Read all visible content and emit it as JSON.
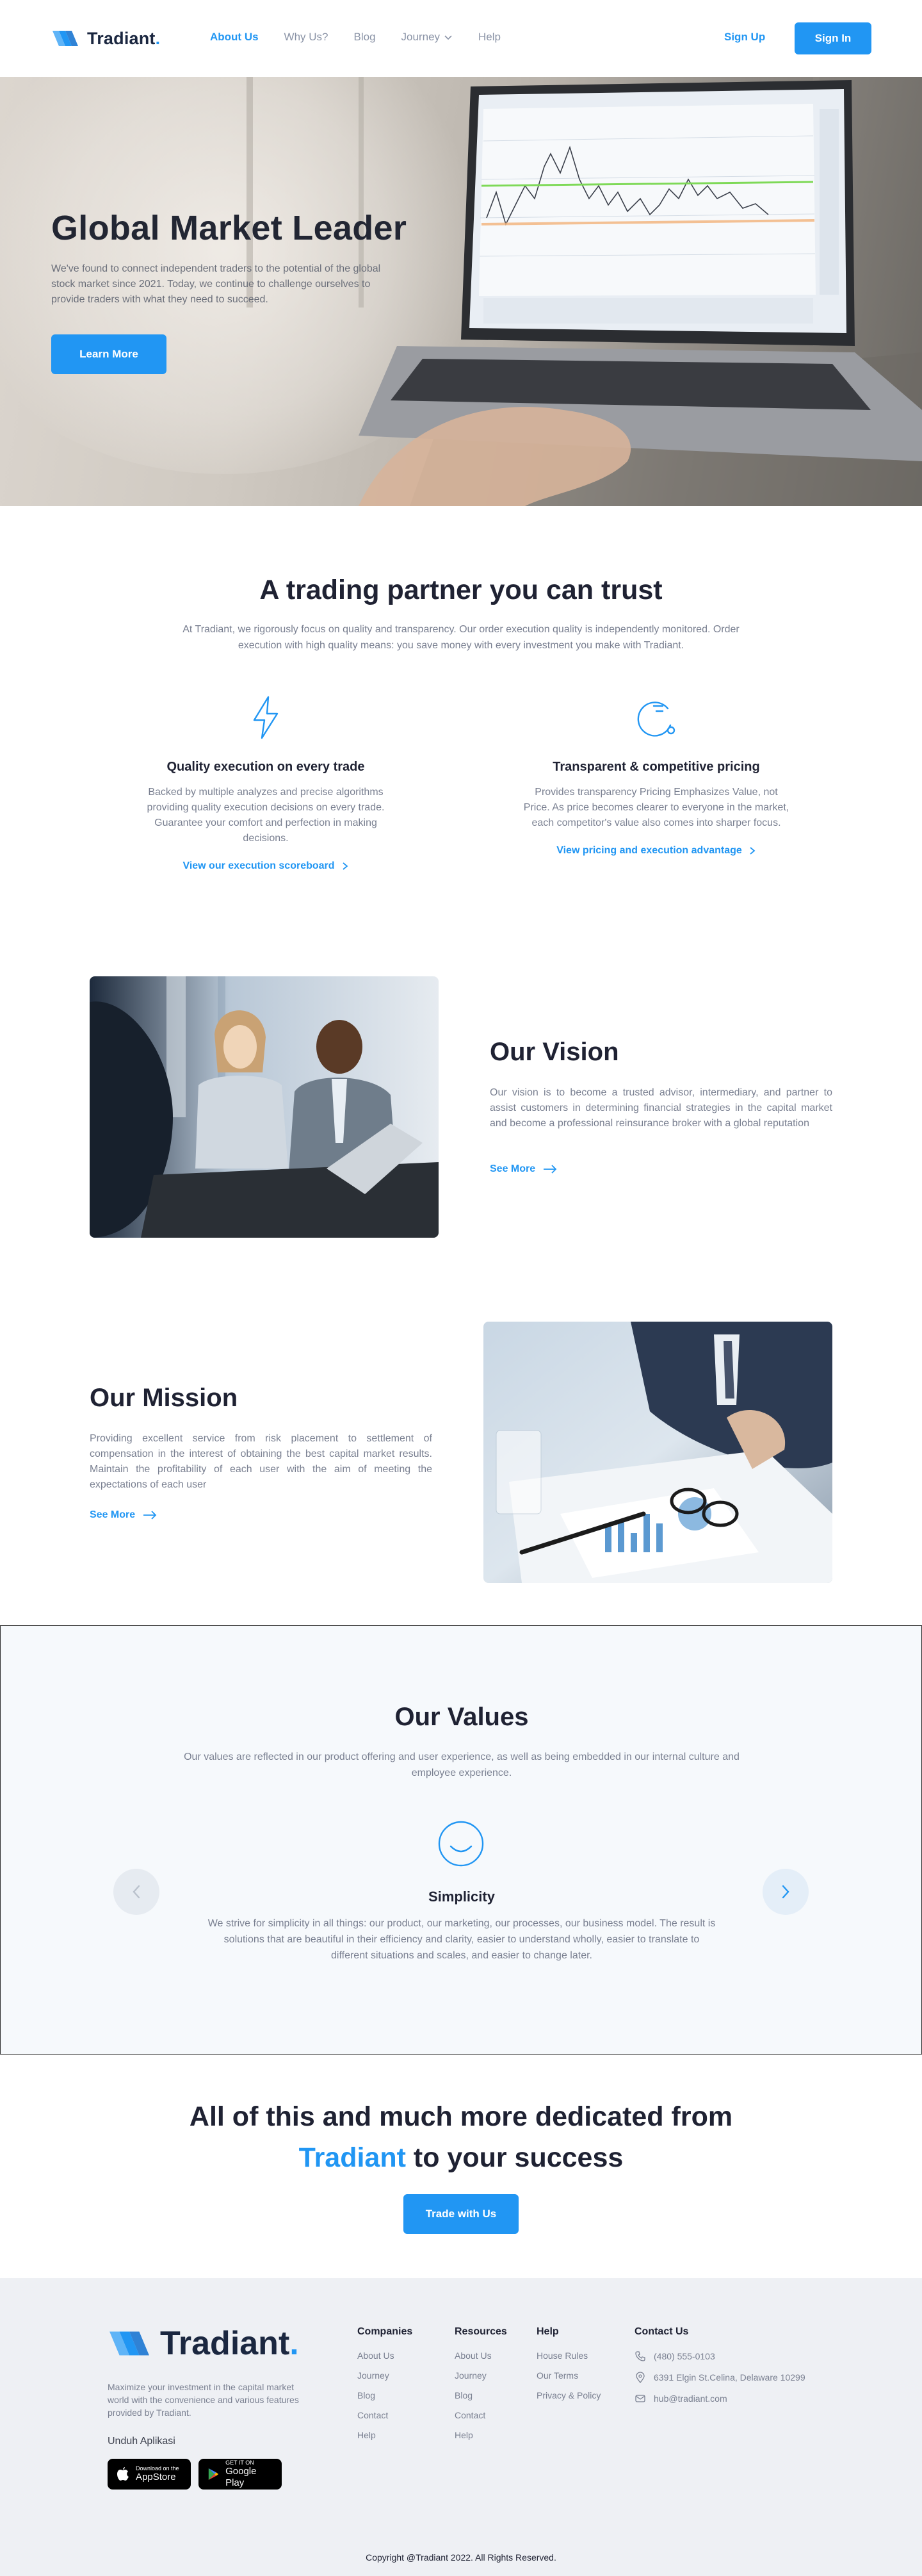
{
  "brand": {
    "name": "Tradiant",
    "dot": ".",
    "accent": "#2196f3",
    "dark": "#1b2740"
  },
  "nav": {
    "links": [
      {
        "label": "About Us",
        "active": true
      },
      {
        "label": "Why Us?"
      },
      {
        "label": "Blog"
      },
      {
        "label": "Journey"
      },
      {
        "label": "Help"
      }
    ],
    "signup": "Sign Up",
    "signin": "Sign In"
  },
  "hero": {
    "title": "Global Market Leader",
    "description": "We've found to connect independent traders to the potential of the global stock market since 2021. Today, we continue to challenge ourselves to provide traders with what they need to succeed.",
    "button": "Learn More"
  },
  "trust": {
    "title": "A trading partner you can trust",
    "description": "At Tradiant, we rigorously focus on quality and transparency. Our order execution quality is independently monitored. Order execution with high quality means: you save money with every investment you make with Tradiant.",
    "features": [
      {
        "icon": "lightning-icon",
        "title": "Quality execution on every trade",
        "description": "Backed by multiple analyzes and precise algorithms providing quality execution decisions on every trade. Guarantee your comfort and perfection in making decisions.",
        "link": "View our execution scoreboard"
      },
      {
        "icon": "pricing-icon",
        "title": "Transparent & competitive pricing",
        "description": "Provides transparency Pricing Emphasizes Value, not Price. As price becomes clearer to everyone in the market, each competitor's value also comes into sharper focus.",
        "link": "View pricing and execution advantage"
      }
    ]
  },
  "vision": {
    "title": "Our Vision",
    "description": "Our vision is to become a trusted advisor, intermediary, and partner to assist customers in determining financial strategies in the capital market and become a professional reinsurance broker with a global reputation",
    "link": "See More"
  },
  "mission": {
    "title": "Our Mission",
    "description": "Providing excellent service from risk placement to settlement of compensation in the interest of obtaining the best capital market results. Maintain the profitability of each user with the aim of meeting the expectations of each user",
    "link": "See More"
  },
  "values": {
    "title": "Our Values",
    "description": "Our values are reflected in our product offering and user experience, as well as being embedded in our internal culture and employee experience.",
    "item": {
      "icon": "smile-icon",
      "title": "Simplicity",
      "description": "We strive for simplicity in all things: our product, our marketing, our processes, our business model. The result is solutions that are beautiful in their efficiency and clarity, easier to understand wholly, easier to translate to different situations and scales, and easier to change later."
    }
  },
  "cta": {
    "line1": "All of this and much more dedicated from",
    "highlight": "Tradiant",
    "line2_rest": " to your success",
    "button": "Trade with Us"
  },
  "footer": {
    "description": "Maximize your investment in the capital market world with the convenience and various features provided by Tradiant.",
    "download_label": "Unduh Aplikasi",
    "appstore": {
      "small": "Download on the",
      "big": "AppStore"
    },
    "googleplay": {
      "small": "GET IT ON",
      "big": "Google Play"
    },
    "columns": [
      {
        "title": "Companies",
        "items": [
          "About Us",
          "Journey",
          "Blog",
          "Contact",
          "Help"
        ]
      },
      {
        "title": "Resources",
        "items": [
          "About Us",
          "Journey",
          "Blog",
          "Contact",
          "Help"
        ]
      },
      {
        "title": "Help",
        "items": [
          "House Rules",
          "Our Terms",
          "Privacy & Policy"
        ]
      }
    ],
    "contact": {
      "title": "Contact Us",
      "phone": "(480) 555-0103",
      "address": "6391 Elgin St.Celina, Delaware 10299",
      "email": "hub@tradiant.com"
    },
    "copyright": "Copyright @Tradiant 2022. All Rights Reserved."
  }
}
